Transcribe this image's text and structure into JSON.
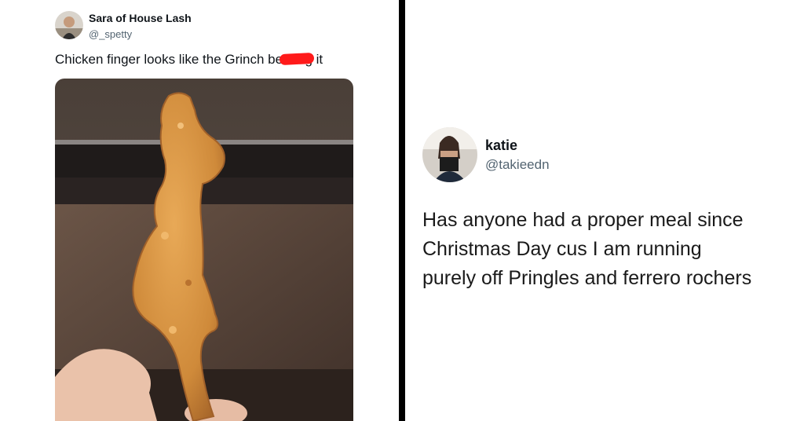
{
  "left_tweet": {
    "name": "Sara of House Lash",
    "handle": "@_spetty",
    "text_before": "Chicken finger looks like the Grinch be",
    "text_redacted": "",
    "text_after": "g it"
  },
  "right_tweet": {
    "name": "katie",
    "handle": "@takieedn",
    "text_lines": [
      "Has anyone had a proper meal since",
      "Christmas Day cus I am running",
      "purely off Pringles and ferrero rochers"
    ]
  },
  "colors": {
    "divider": "#000000",
    "handle": "#536471",
    "redaction": "#ff1a1a"
  }
}
